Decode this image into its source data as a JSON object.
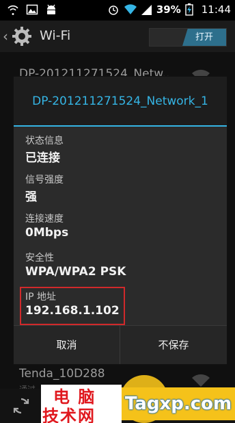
{
  "status_bar": {
    "battery_percent": "39%",
    "time": "11:44"
  },
  "action_bar": {
    "title": "Wi-Fi",
    "toggle_label": "打开"
  },
  "background_list": {
    "top_network": "DP-201211271524_Netw..",
    "bottom_network": "Tenda_10D288",
    "bottom_sub": "通过"
  },
  "dialog": {
    "title": "DP-201211271524_Network_1",
    "fields": [
      {
        "label": "状态信息",
        "value": "已连接"
      },
      {
        "label": "信号强度",
        "value": "强"
      },
      {
        "label": "连接速度",
        "value": "0Mbps"
      },
      {
        "label": "安全性",
        "value": "WPA/WPA2 PSK"
      },
      {
        "label": "IP 地址",
        "value": "192.168.1.102"
      }
    ],
    "buttons": {
      "cancel": "取消",
      "forget": "不保存"
    }
  },
  "watermark": {
    "cn_line1": "电 脑",
    "cn_line2": "技术网",
    "en": "Tagxp.com"
  },
  "colors": {
    "accent": "#35b5e5",
    "highlight_border": "#d1292b",
    "toggle_on": "#2d6f8c"
  }
}
